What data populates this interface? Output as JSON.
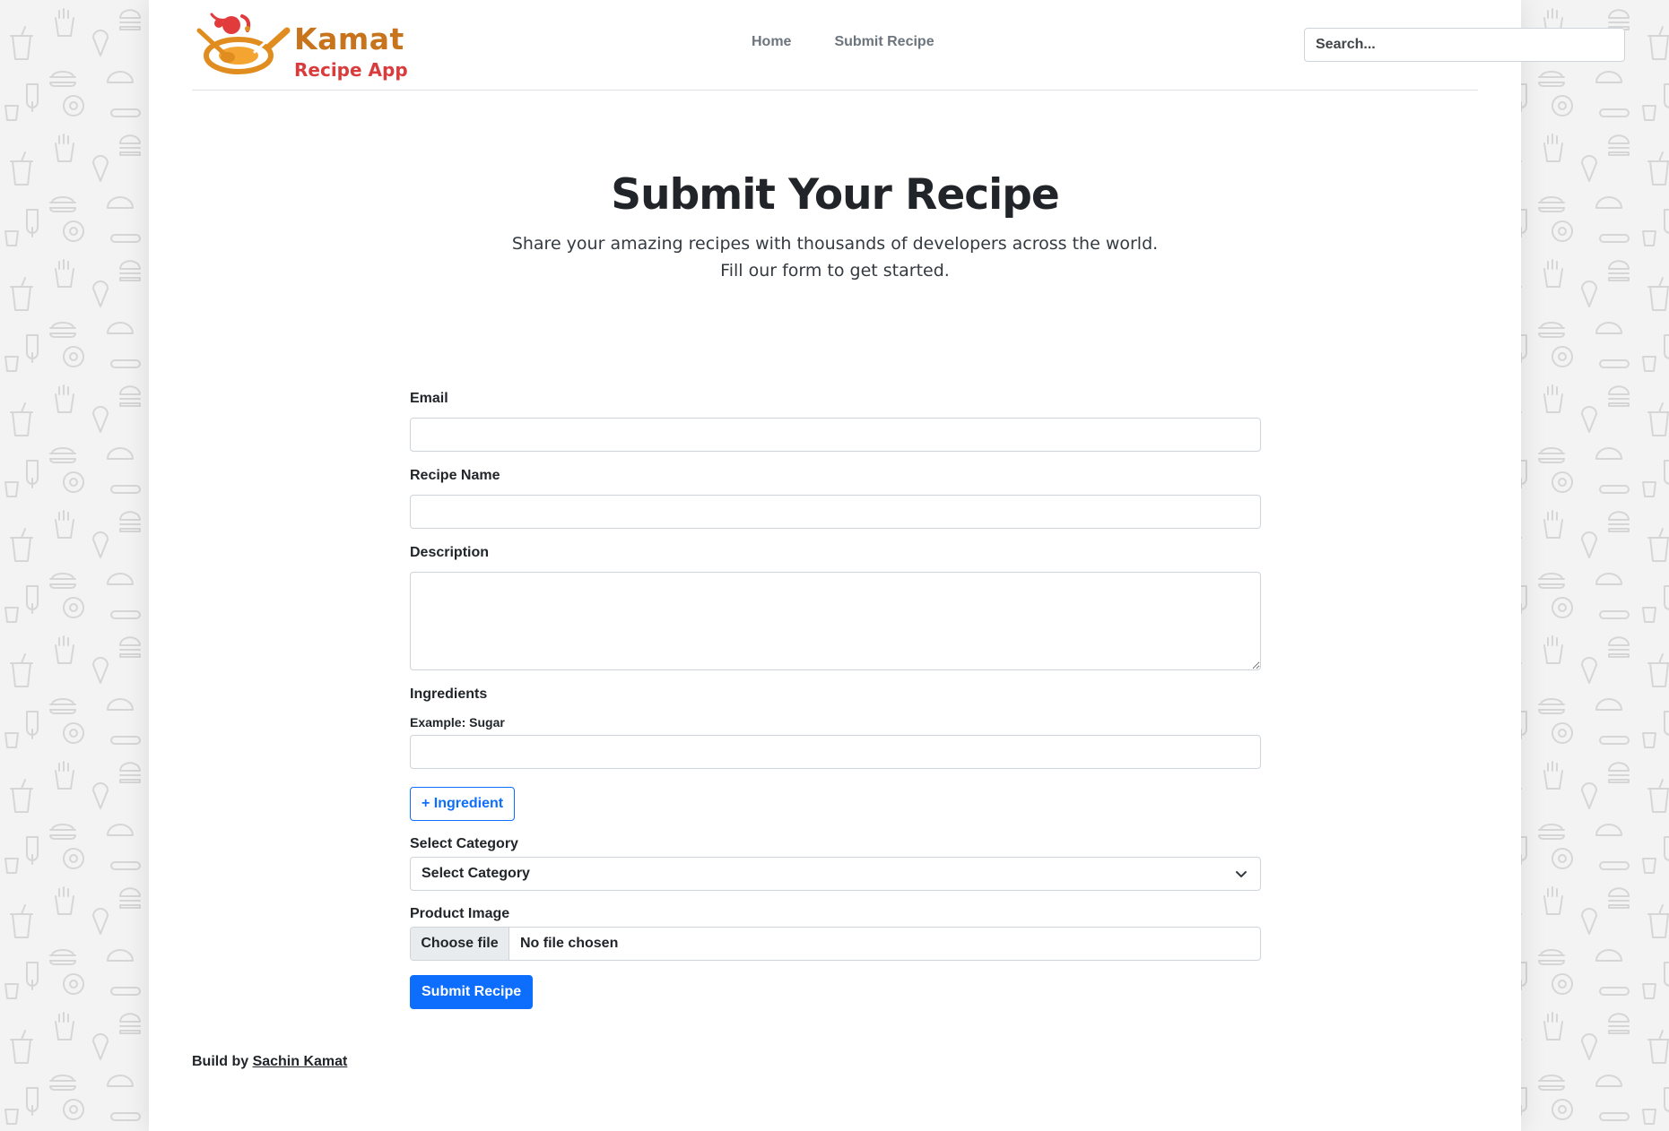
{
  "colors": {
    "primary": "#0d6efd",
    "logo_orange": "#c8741d",
    "logo_red": "#d93c3c",
    "background": "#f3f3f3"
  },
  "header": {
    "logo": {
      "icon": "pan-with-food-icon",
      "title": "Kamat",
      "subtitle": "Recipe App"
    },
    "nav": [
      {
        "label": "Home"
      },
      {
        "label": "Submit Recipe"
      }
    ],
    "search": {
      "placeholder": "Search...",
      "value": ""
    }
  },
  "hero": {
    "title": "Submit Your Recipe",
    "line1": "Share your amazing recipes with thousands of developers across the world.",
    "line2": "Fill our form to get started."
  },
  "form": {
    "email_label": "Email",
    "recipe_name_label": "Recipe Name",
    "description_label": "Description",
    "ingredients_label": "Ingredients",
    "ingredient_hint": "Example: Sugar",
    "add_ingredient_label": "+ Ingredient",
    "category_label": "Select Category",
    "category_selected": "Select Category",
    "image_label": "Product Image",
    "choose_file_label": "Choose file",
    "no_file_label": "No file chosen",
    "submit_label": "Submit Recipe"
  },
  "footer": {
    "text": "Build by",
    "author": "Sachin Kamat"
  }
}
